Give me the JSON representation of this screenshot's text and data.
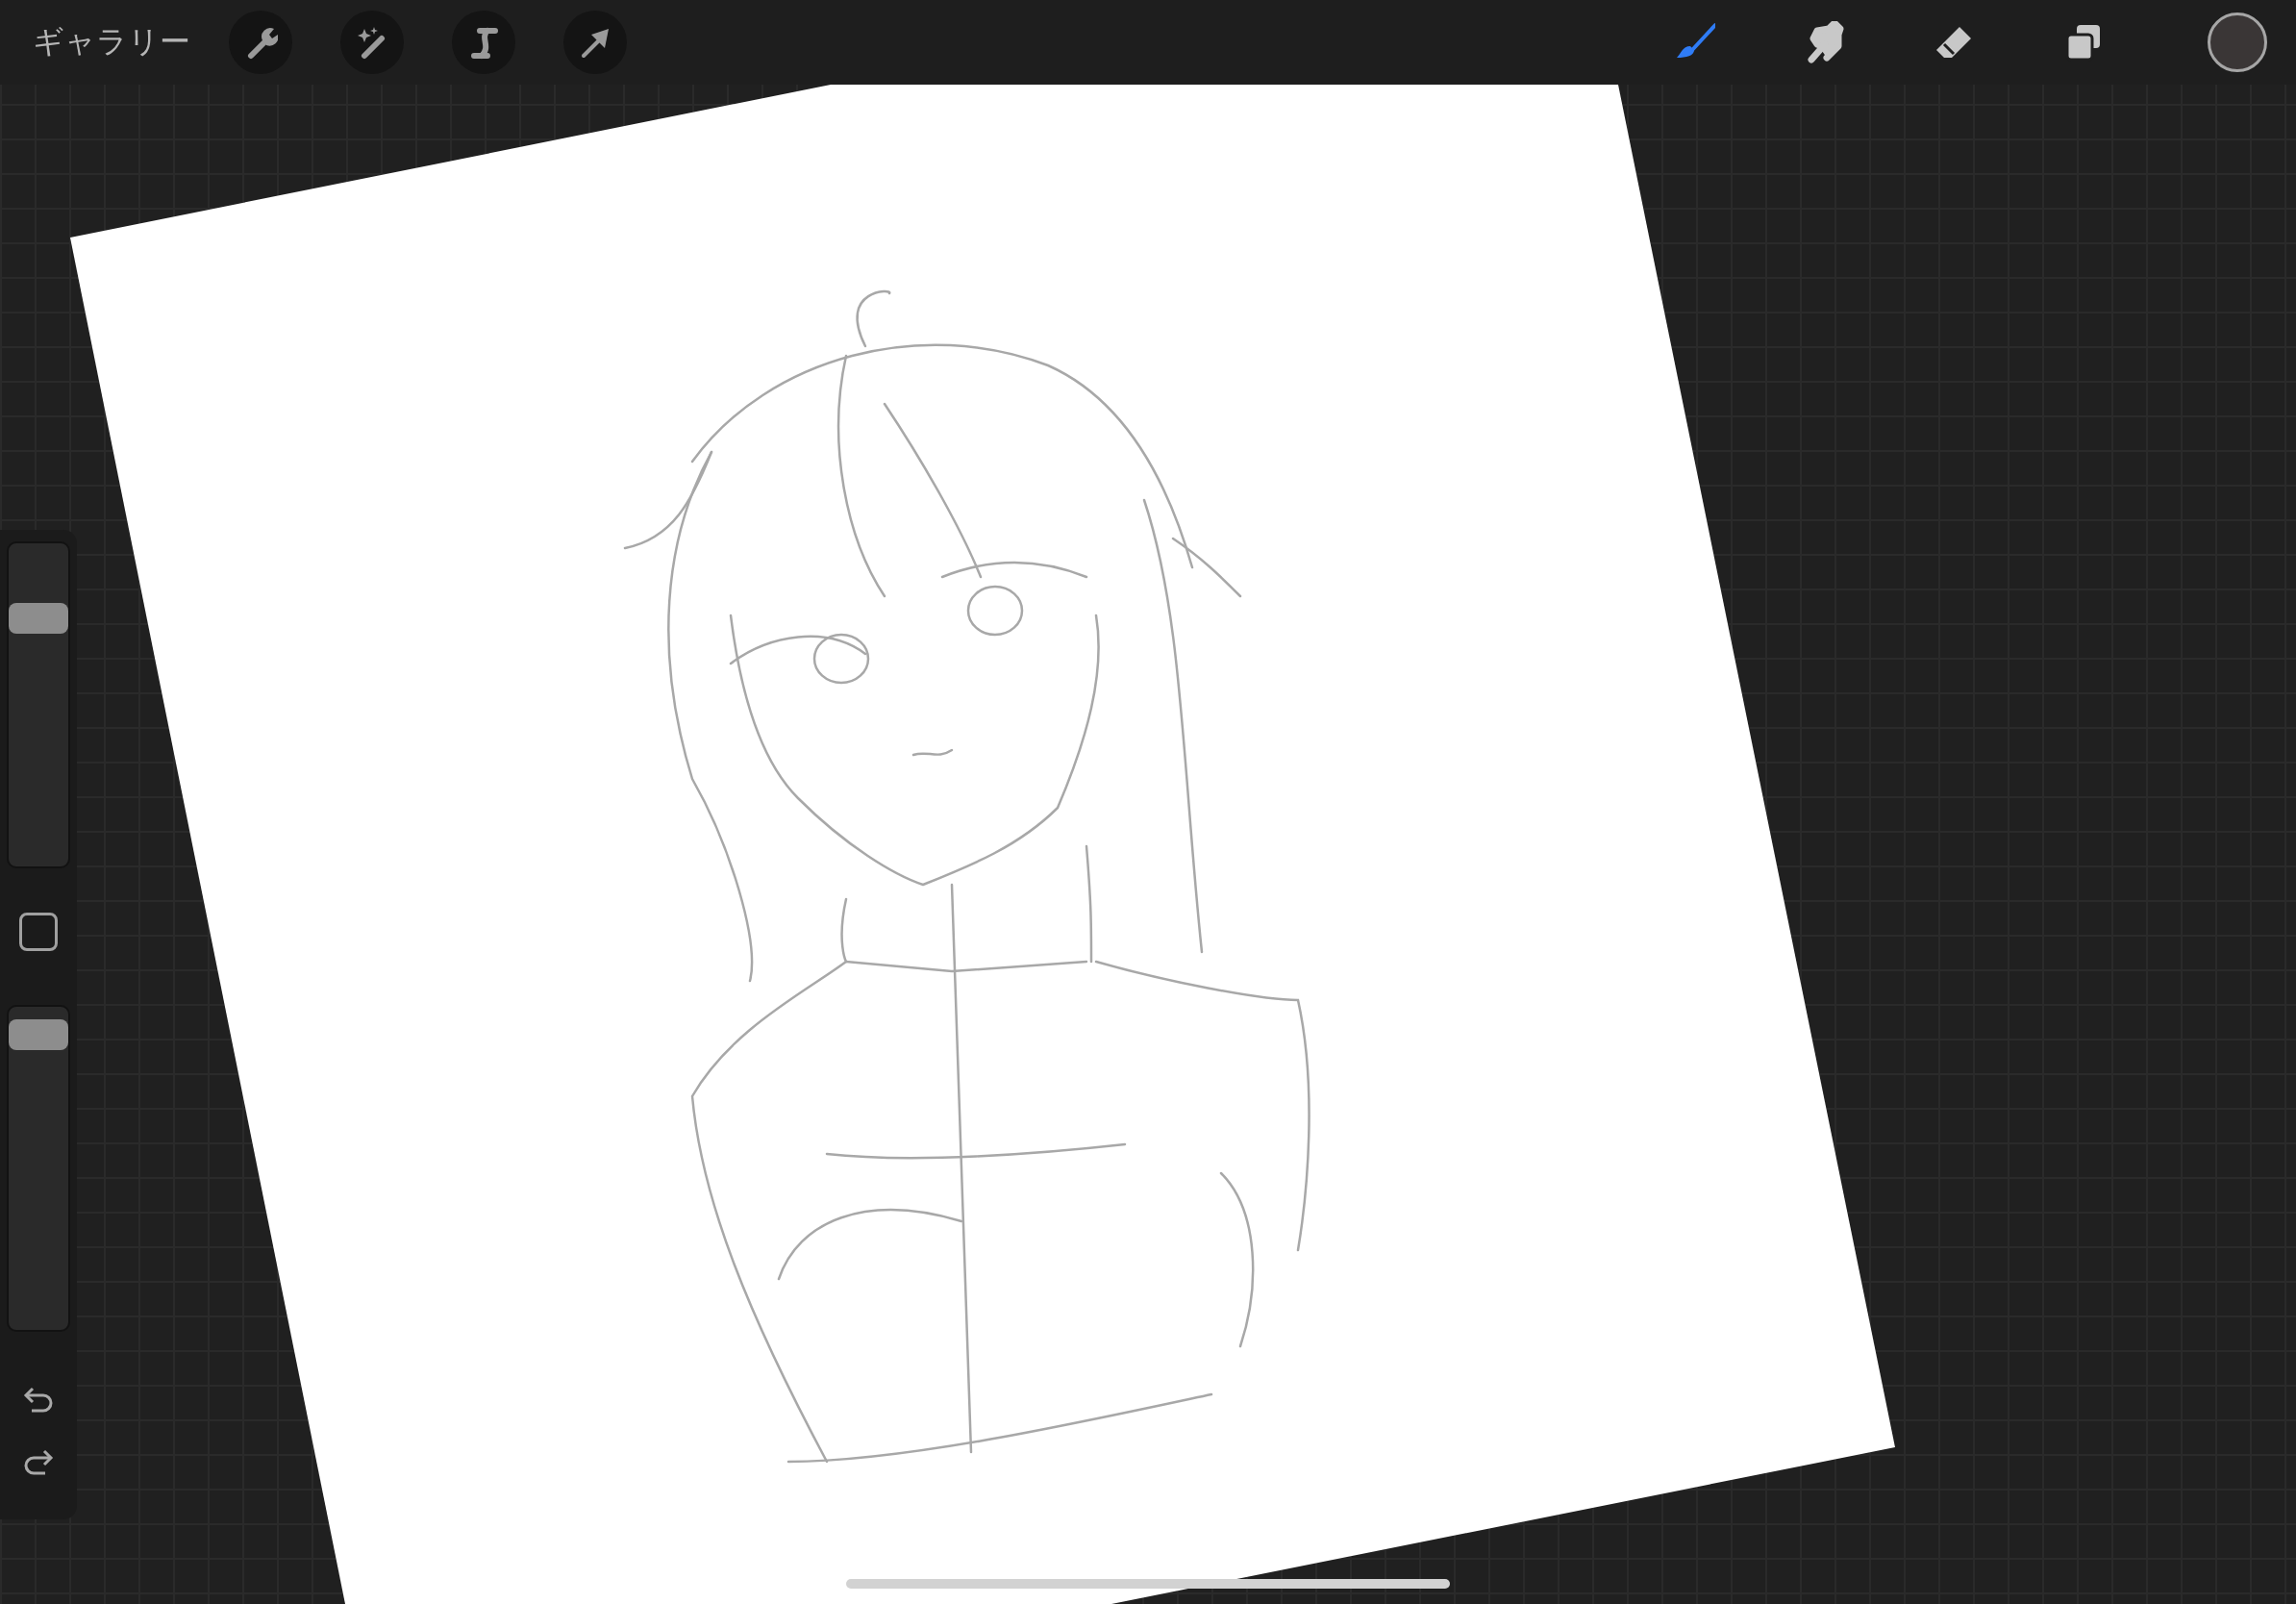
{
  "top_bar": {
    "gallery_label": "ギャラリー",
    "actions": [
      {
        "kind": "wrench"
      },
      {
        "kind": "wand"
      },
      {
        "kind": "selection"
      },
      {
        "kind": "transform"
      }
    ],
    "tools": [
      {
        "kind": "brush",
        "selected": true
      },
      {
        "kind": "smudge",
        "selected": false
      },
      {
        "kind": "eraser",
        "selected": false
      },
      {
        "kind": "layers",
        "selected": false
      }
    ],
    "current_color": {
      "color": "#3a3636"
    }
  },
  "sidebar": {
    "size_slider": {
      "level": 0.8
    },
    "opacity_slider": {
      "level": 0.97
    }
  }
}
